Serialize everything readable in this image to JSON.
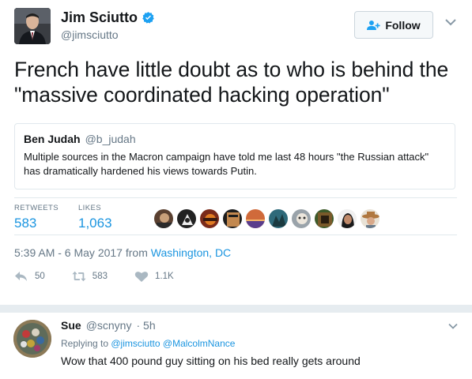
{
  "tweet": {
    "author_name": "Jim Sciutto",
    "author_handle": "@jimsciutto",
    "follow_label": "Follow",
    "text": "French have little doubt as to who is behind the \"massive coordinated hacking operation\"",
    "quote": {
      "name": "Ben Judah",
      "handle": "@b_judah",
      "text": "Multiple sources in the Macron campaign have told me last 48 hours \"the Russian attack\" has dramatically hardened his views towards Putin."
    },
    "stats": {
      "retweets_label": "RETWEETS",
      "retweets_count": "583",
      "likes_label": "LIKES",
      "likes_count": "1,063"
    },
    "timestamp": "5:39 AM - 6 May 2017 from ",
    "location": "Washington, DC",
    "actions": {
      "reply_count": "50",
      "retweet_count": "583",
      "like_count": "1.1K"
    }
  },
  "reply": {
    "name": "Sue",
    "handle": "@scnyny",
    "time": "· 5h",
    "replying_prefix": "Replying to ",
    "replying_mentions": "@jimsciutto @MalcolmNance",
    "text": "Wow that 400 pound guy sitting on his bed really gets around"
  },
  "colors": {
    "link": "#1b95e0",
    "verified": "#1da1f2",
    "muted": "#657786",
    "divider": "#e1e8ed"
  }
}
